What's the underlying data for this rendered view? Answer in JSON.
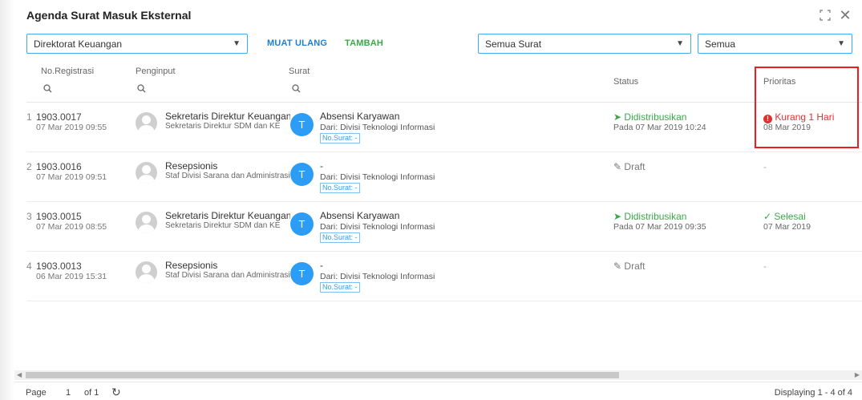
{
  "window": {
    "title": "Agenda Surat Masuk Eksternal",
    "maximize_icon": "⛶",
    "close_icon": "✕"
  },
  "toolbar": {
    "unit_select": "Direktorat Keuangan",
    "reload_label": "MUAT ULANG",
    "add_label": "TAMBAH",
    "type_select": "Semua Surat",
    "filter_select": "Semua"
  },
  "columns": {
    "registrasi": "No.Registrasi",
    "penginput": "Penginput",
    "surat": "Surat",
    "status": "Status",
    "prioritas": "Prioritas"
  },
  "rows": [
    {
      "num": "1",
      "reg": "1903.0017",
      "date": "07 Mar 2019 09:55",
      "person": "Sekretaris Direktur Keuangan",
      "role": "Sekretaris Direktur SDM dan KE",
      "avatar_letter": "T",
      "subject": "Absensi Karyawan",
      "from": "Dari: Divisi Teknologi Informasi",
      "no_surat": "No.Surat: -",
      "status": "Didistribusikan",
      "status_sub": "Pada 07 Mar 2019 10:24",
      "status_icon": "➤",
      "priority": "Kurang 1 Hari",
      "priority_sub": "08 Mar 2019",
      "priority_icon": "!"
    },
    {
      "num": "2",
      "reg": "1903.0016",
      "date": "07 Mar 2019 09:51",
      "person": "Resepsionis",
      "role": "Staf Divisi Sarana dan Administrasi",
      "avatar_letter": "T",
      "subject": "-",
      "from": "Dari: Divisi Teknologi Informasi",
      "no_surat": "No.Surat: -",
      "status": "Draft",
      "status_sub": "",
      "status_icon": "✎",
      "priority": "-",
      "priority_sub": "",
      "priority_icon": ""
    },
    {
      "num": "3",
      "reg": "1903.0015",
      "date": "07 Mar 2019 08:55",
      "person": "Sekretaris Direktur Keuangan",
      "role": "Sekretaris Direktur SDM dan KE",
      "avatar_letter": "T",
      "subject": "Absensi Karyawan",
      "from": "Dari: Divisi Teknologi Informasi",
      "no_surat": "No.Surat: -",
      "status": "Didistribusikan",
      "status_sub": "Pada 07 Mar 2019 09:35",
      "status_icon": "➤",
      "priority": "Selesai",
      "priority_sub": "07 Mar 2019",
      "priority_icon": "✓"
    },
    {
      "num": "4",
      "reg": "1903.0013",
      "date": "06 Mar 2019 15:31",
      "person": "Resepsionis",
      "role": "Staf Divisi Sarana dan Administrasi",
      "avatar_letter": "T",
      "subject": "-",
      "from": "Dari: Divisi Teknologi Informasi",
      "no_surat": "No.Surat: -",
      "status": "Draft",
      "status_sub": "",
      "status_icon": "✎",
      "priority": "-",
      "priority_sub": "",
      "priority_icon": ""
    }
  ],
  "pager": {
    "page_label": "Page",
    "page": "1",
    "of_label": "of 1",
    "refresh_icon": "↻",
    "display": "Displaying 1 - 4 of 4"
  },
  "colors": {
    "accent": "#3fa9f5",
    "green": "#3ca74a",
    "red": "#e03030",
    "avatar_blue": "#2d9cf5",
    "highlight": "#ef1d1d"
  }
}
